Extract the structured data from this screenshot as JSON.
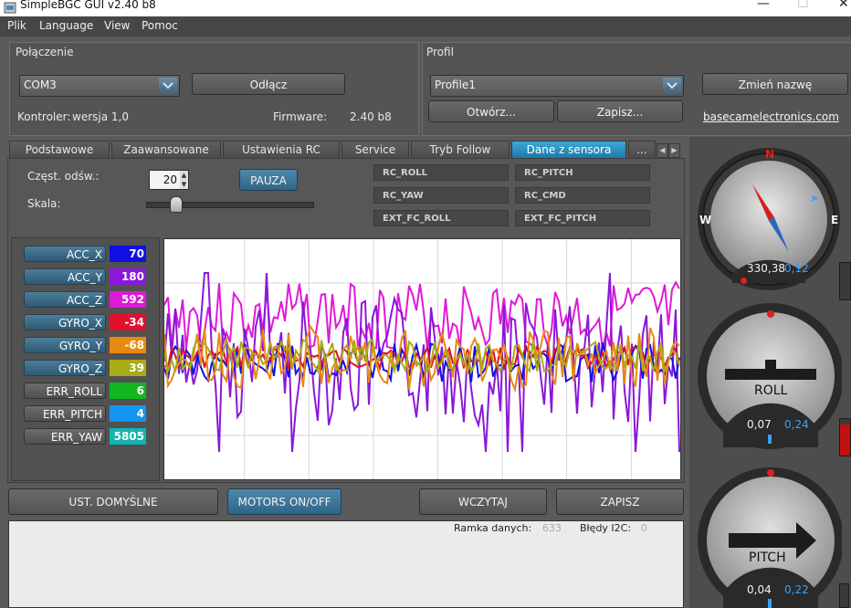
{
  "window": {
    "title": "SimpleBGC GUI v2.40 b8"
  },
  "menu": {
    "items": [
      "Plik",
      "Language",
      "View",
      "Pomoc"
    ]
  },
  "connection": {
    "group_label": "Połączenie",
    "port": "COM3",
    "disconnect_label": "Odłącz",
    "controller_label": "Kontroler:",
    "controller_value": "wersja 1,0",
    "firmware_label": "Firmware:",
    "firmware_value": "2.40 b8"
  },
  "profile": {
    "group_label": "Profil",
    "name": "Profile1",
    "rename_label": "Zmień nazwę",
    "open_label": "Otwórz...",
    "save_label": "Zapisz...",
    "link": "basecamelectronics.com"
  },
  "tabs": [
    "Podstawowe",
    "Zaawansowane",
    "Ustawienia RC",
    "Service",
    "Tryb Follow",
    "Dane z sensora",
    "..."
  ],
  "controls": {
    "rate_label": "Częst. odśw.:",
    "rate_value": "20",
    "scale_label": "Skala:",
    "scale_level": 0.15,
    "pause_label": "PAUZA"
  },
  "rc_channels": [
    "RC_ROLL",
    "RC_PITCH",
    "RC_YAW",
    "RC_CMD",
    "EXT_FC_ROLL",
    "EXT_FC_PITCH"
  ],
  "sensors": [
    {
      "name": "ACC_X",
      "value": "70",
      "color": "#1010e6",
      "active": true
    },
    {
      "name": "ACC_Y",
      "value": "180",
      "color": "#8a18d8",
      "active": true
    },
    {
      "name": "ACC_Z",
      "value": "592",
      "color": "#e018d8",
      "active": true
    },
    {
      "name": "GYRO_X",
      "value": "-34",
      "color": "#e0102c",
      "active": true
    },
    {
      "name": "GYRO_Y",
      "value": "-68",
      "color": "#e88a10",
      "active": true
    },
    {
      "name": "GYRO_Z",
      "value": "39",
      "color": "#a8ac16",
      "active": true
    },
    {
      "name": "ERR_ROLL",
      "value": "6",
      "color": "#12b81e",
      "active": false
    },
    {
      "name": "ERR_PITCH",
      "value": "4",
      "color": "#1296f0",
      "active": false
    },
    {
      "name": "ERR_YAW",
      "value": "5805",
      "color": "#12b4b0",
      "active": false
    }
  ],
  "bottom": {
    "defaults_label": "UST. DOMYŚLNE",
    "motors_label": "MOTORS ON/OFF",
    "read_label": "WCZYTAJ",
    "write_label": "ZAPISZ"
  },
  "status": {
    "frame_label": "Ramka danych:",
    "frame_value": "633",
    "i2c_label": "Błędy I2C:",
    "i2c_value": "0"
  },
  "gauges": {
    "compass": {
      "n": "N",
      "w": "W",
      "e": "E",
      "value1": "330,38",
      "value2": "0,12"
    },
    "roll": {
      "label": "ROLL",
      "value1": "0,07",
      "value2": "0,24"
    },
    "pitch": {
      "label": "PITCH",
      "value1": "0,04",
      "value2": "0,22"
    }
  },
  "colors": {
    "accent_blue": "#3fa7d6",
    "value_blue": "#3aa0ff",
    "indicator_red": "#d01010"
  }
}
